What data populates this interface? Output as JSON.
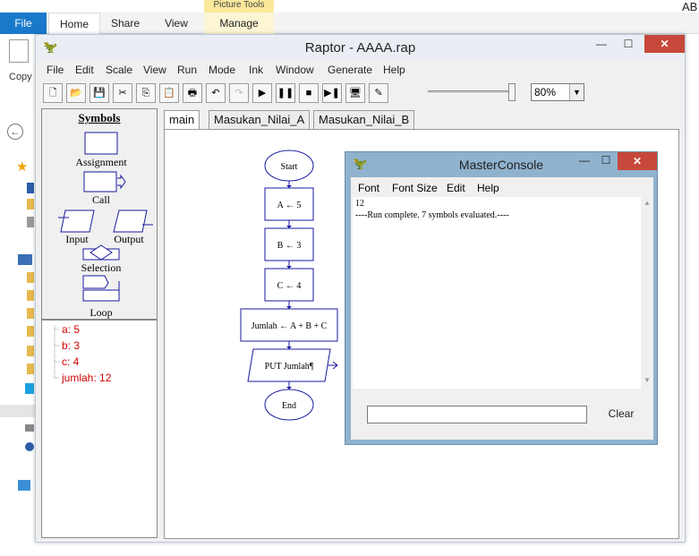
{
  "explorer": {
    "file_tab": "File",
    "tabs": [
      "Home",
      "Share",
      "View"
    ],
    "contextual_group": "Picture Tools",
    "manage_tab": "Manage",
    "copy_label": "Copy",
    "corner_text": "AB"
  },
  "raptor": {
    "title": "Raptor - AAAA.rap",
    "menu": [
      "File",
      "Edit",
      "Scale",
      "View",
      "Run",
      "Mode",
      "Ink",
      "Window",
      "Generate",
      "Help"
    ],
    "toolbar_icons": [
      "new-file-icon",
      "open-folder-icon",
      "save-icon",
      "cut-icon",
      "copy-icon",
      "paste-icon",
      "print-icon",
      "undo-icon",
      "redo-icon",
      "run-icon",
      "pause-icon",
      "stop-icon",
      "step-icon",
      "test-server-icon",
      "ink-pen-icon"
    ],
    "zoom": "80%",
    "symbols": {
      "title": "Symbols",
      "assignment": "Assignment",
      "call": "Call",
      "input": "Input",
      "output": "Output",
      "selection": "Selection",
      "loop": "Loop"
    },
    "variables": [
      "a: 5",
      "b: 3",
      "c: 4",
      "jumlah: 12"
    ],
    "tabs": [
      "main",
      "Masukan_Nilai_A",
      "Masukan_Nilai_B"
    ],
    "flowchart": {
      "start": "Start",
      "steps": [
        "A ← 5",
        "B ← 3",
        "C ← 4",
        "Jumlah ← A + B + C"
      ],
      "output": "PUT Jumlah¶",
      "end": "End"
    }
  },
  "console": {
    "title": "MasterConsole",
    "menu": [
      "Font",
      "Font Size",
      "Edit",
      "Help"
    ],
    "lines": [
      "12",
      "----Run complete.  7 symbols evaluated.----"
    ],
    "input_value": "",
    "clear_label": "Clear"
  }
}
